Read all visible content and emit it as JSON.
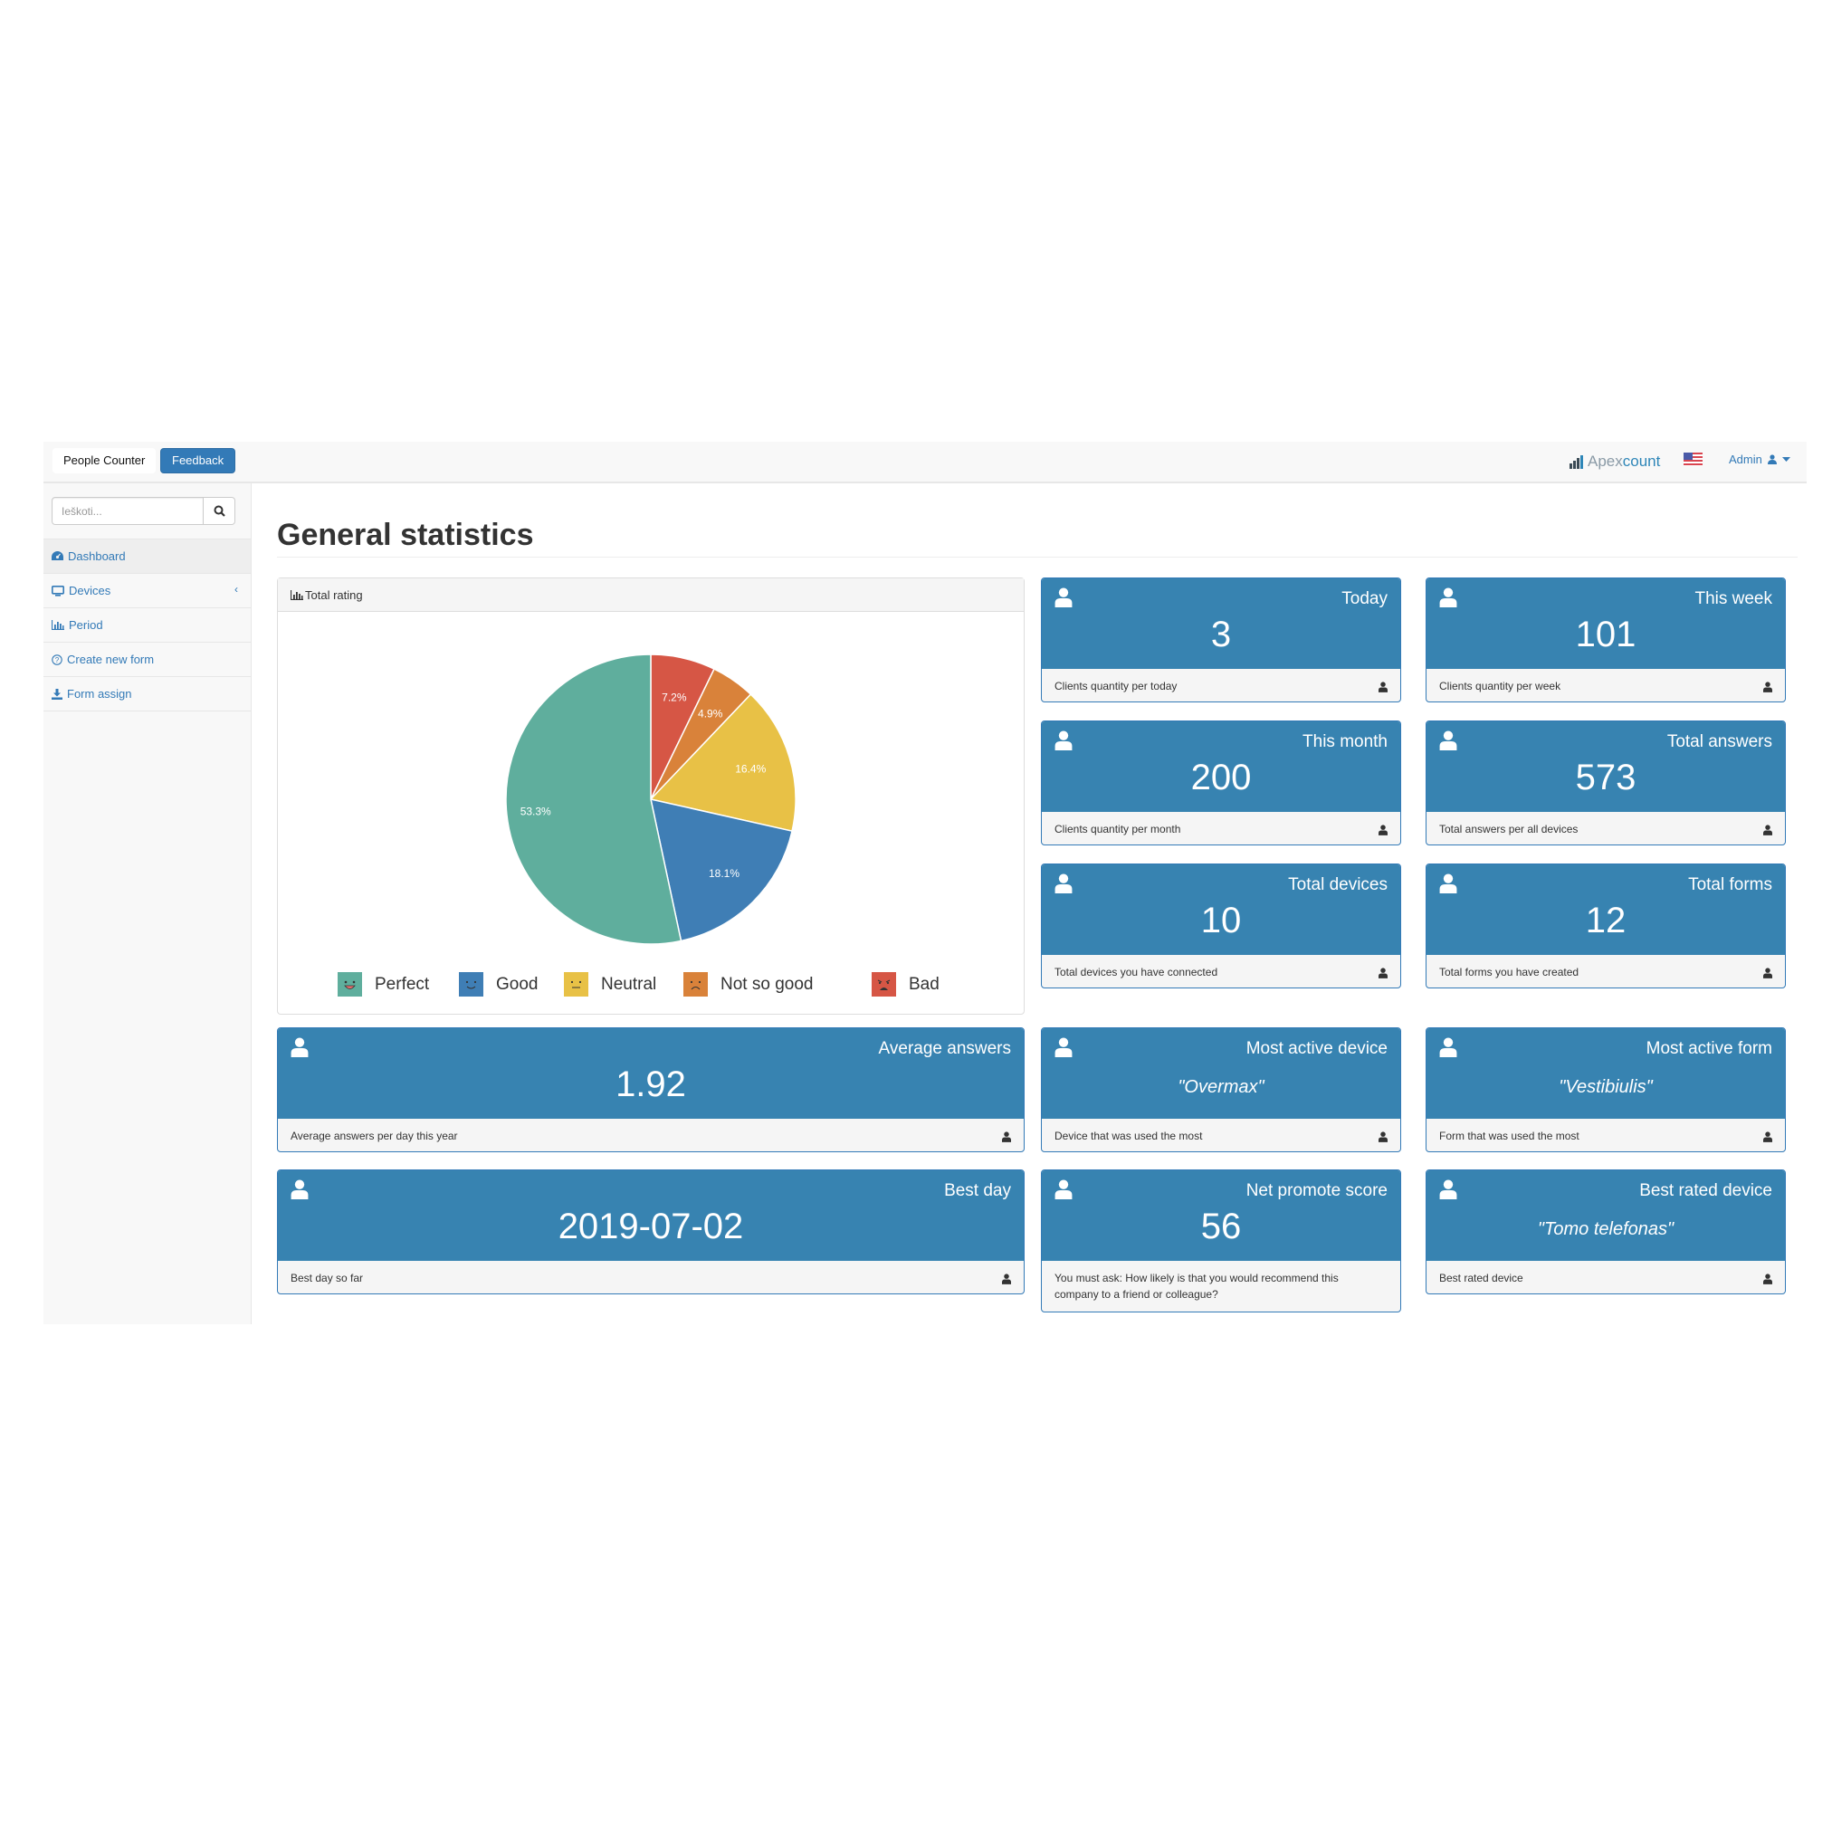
{
  "topnav": {
    "brand": "People Counter",
    "feedback_label": "Feedback",
    "logo_text_a": "Apex",
    "logo_text_b": "count",
    "flag_icon": "us-flag-icon",
    "user_label": "Admin"
  },
  "sidebar": {
    "search_placeholder": "Ieškoti...",
    "items": [
      {
        "label": "Dashboard",
        "icon": "dashboard-icon",
        "active": true
      },
      {
        "label": "Devices",
        "icon": "desktop-icon",
        "has_submenu": true
      },
      {
        "label": "Period",
        "icon": "bar-chart-icon"
      },
      {
        "label": "Create new form",
        "icon": "question-circle-icon"
      },
      {
        "label": "Form assign",
        "icon": "download-icon"
      }
    ]
  },
  "main": {
    "title": "General statistics",
    "rating_panel": {
      "title": "Total rating"
    }
  },
  "chart_data": {
    "type": "pie",
    "title": "Total rating",
    "categories": [
      "Perfect",
      "Good",
      "Neutral",
      "Not so good",
      "Bad"
    ],
    "values": [
      53.3,
      18.1,
      16.4,
      4.9,
      7.2
    ],
    "labels": [
      "53.3%",
      "18.1%",
      "16.4%",
      "4.9%",
      "7.2%"
    ],
    "colors": [
      "#5fae9d",
      "#3f7eb5",
      "#e8c146",
      "#d9823a",
      "#d65645"
    ],
    "legend_position": "bottom",
    "start": "12 o'clock, counter-clockwise from Bad",
    "order_clockwise_from_top": [
      "Bad",
      "Not so good",
      "Neutral",
      "Good",
      "Perfect"
    ]
  },
  "cards": [
    {
      "label": "Today",
      "value": "3",
      "footer": "Clients quantity per today"
    },
    {
      "label": "This week",
      "value": "101",
      "footer": "Clients quantity per week"
    },
    {
      "label": "This month",
      "value": "200",
      "footer": "Clients quantity per month"
    },
    {
      "label": "Total answers",
      "value": "573",
      "footer": "Total answers per all devices"
    },
    {
      "label": "Total devices",
      "value": "10",
      "footer": "Total devices you have connected"
    },
    {
      "label": "Total forms",
      "value": "12",
      "footer": "Total forms you have created"
    },
    {
      "label": "Average answers",
      "value": "1.92",
      "footer": "Average answers per day this year"
    },
    {
      "label": "Most active device",
      "value": "\"Overmax\"",
      "footer": "Device that was used the most"
    },
    {
      "label": "Most active form",
      "value": "\"Vestibiulis\"",
      "footer": "Form that was used the most"
    },
    {
      "label": "Best day",
      "value": "2019-07-02",
      "footer": "Best day so far"
    },
    {
      "label": "Net promote score",
      "value": "56",
      "footer": "You must ask: How likely is that you would recommend this company to a friend or colleague?"
    },
    {
      "label": "Best rated device",
      "value": "\"Tomo telefonas\"",
      "footer": "Best rated device"
    }
  ],
  "colors": {
    "primary": "#337ab7",
    "card_head": "#3783b1"
  }
}
